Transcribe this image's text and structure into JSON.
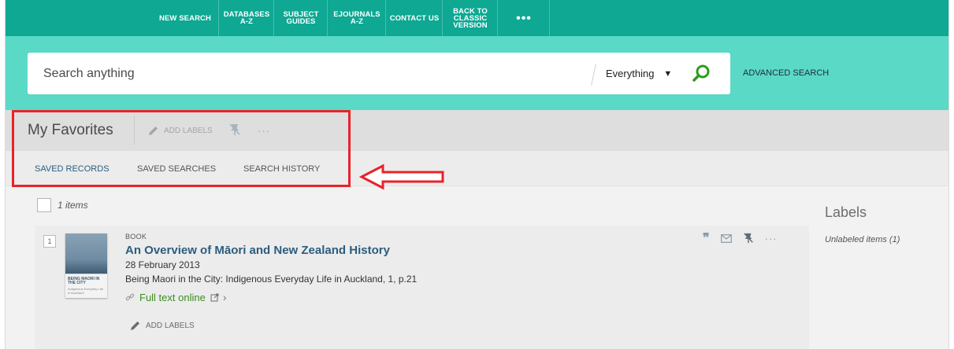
{
  "nav": {
    "items": [
      {
        "label": "NEW SEARCH"
      },
      {
        "label": "DATABASES\nA-Z"
      },
      {
        "label": "SUBJECT\nGUIDES"
      },
      {
        "label": "EJOURNALS\nA-Z"
      },
      {
        "label": "CONTACT US"
      },
      {
        "label": "BACK TO\nCLASSIC\nVERSION"
      },
      {
        "label": "•••"
      }
    ]
  },
  "search": {
    "placeholder": "Search anything",
    "scope": "Everything",
    "advanced_label": "ADVANCED SEARCH"
  },
  "favorites": {
    "title": "My Favorites",
    "add_labels": "ADD LABELS",
    "more": "···"
  },
  "tabs": [
    {
      "label": "SAVED RECORDS",
      "active": true
    },
    {
      "label": "SAVED SEARCHES",
      "active": false
    },
    {
      "label": "SEARCH HISTORY",
      "active": false
    }
  ],
  "results": {
    "count_label": "1 items",
    "items": [
      {
        "number": "1",
        "type": "BOOK",
        "title": "An Overview of Māori and New Zealand History",
        "date": "28 February 2013",
        "source": "Being Maori in the City: Indigenous Everyday Life in Auckland, 1, p.21",
        "availability": "Full text online",
        "add_labels": "ADD LABELS",
        "more": "···",
        "cover_title": "BEING MAORI IN THE CITY",
        "cover_subtitle": "Indigenous Everyday Life in Auckland"
      }
    ]
  },
  "labels_panel": {
    "heading": "Labels",
    "items": [
      {
        "label": "Unlabeled items (1)"
      }
    ]
  },
  "colors": {
    "nav_bg": "#0ea893",
    "search_band": "#5ad9c6",
    "link": "#2a5d7f",
    "availability": "#3b8e1f",
    "highlight": "#e8232a"
  }
}
